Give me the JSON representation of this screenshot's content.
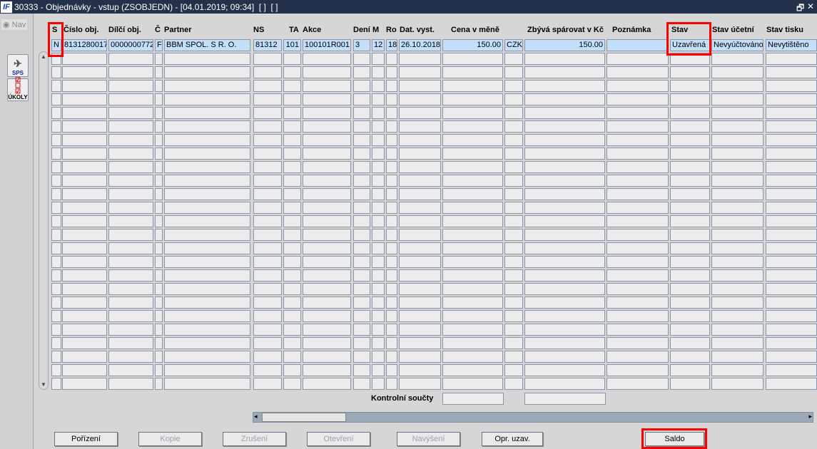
{
  "window": {
    "logo": "IF",
    "title": "30333 - Objednávky - vstup (ZSOBJEDN) - [04.01.2019; 09:34]  [ ]  [ ]",
    "restore": "🗗",
    "close": "✕"
  },
  "sidebar": {
    "nav": "Nav",
    "sps": "SPS",
    "ukoly": "ÚKOLY"
  },
  "columns": [
    "S",
    "Číslo obj.",
    "Dílčí obj.",
    "Č",
    "Partner",
    "NS",
    "TA",
    "Akce",
    "Dení",
    "M",
    "Ro",
    "Dat. vyst.",
    "Cena v měně",
    "",
    "Zbývá spárovat v Kč",
    "Poznámka",
    "Stav",
    "Stav účetní",
    "Stav tisku"
  ],
  "rows": [
    [
      "N",
      "8131280017",
      "0000000772",
      "F",
      "BBM SPOL. S R. O.",
      "81312",
      "101",
      "100101R001 '",
      "3",
      "12",
      "18",
      "26.10.2018",
      "150.00",
      "CZK",
      "150.00",
      "",
      "Uzavřená",
      "Nevyúčtováno",
      "Nevytištěno"
    ]
  ],
  "empty_rows": 25,
  "totals": {
    "label": "Kontrolní součty"
  },
  "buttons": [
    {
      "label": "Pořízení",
      "enabled": true
    },
    {
      "label": "Kopie",
      "enabled": false
    },
    {
      "label": "Zrušení",
      "enabled": false
    },
    {
      "label": "Otevření",
      "enabled": false
    },
    {
      "label": "Navýšení",
      "enabled": false
    },
    {
      "label": "Opr. uzav.",
      "enabled": true
    },
    {
      "label": "Saldo",
      "enabled": true
    }
  ]
}
